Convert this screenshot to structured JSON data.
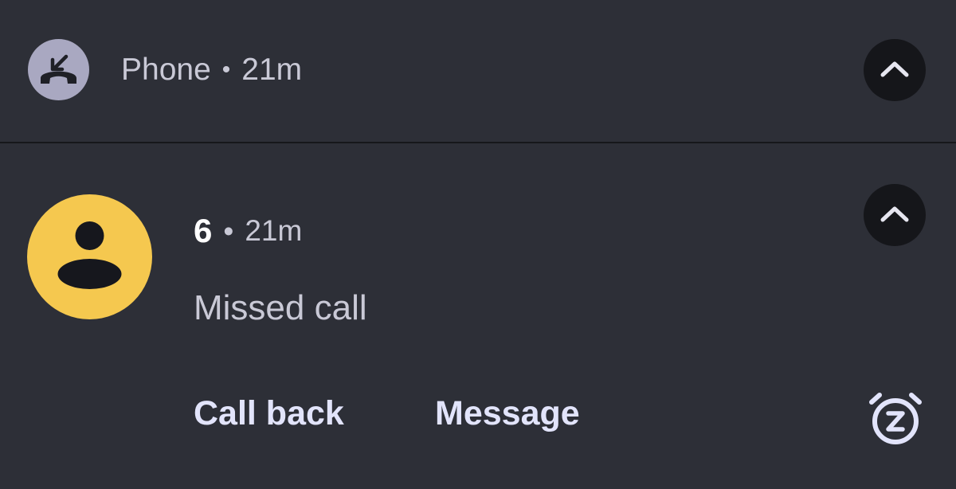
{
  "header": {
    "app_icon": "missed-call-icon",
    "app_name": "Phone",
    "separator": "•",
    "time": "21m",
    "collapse_icon": "chevron-up-icon"
  },
  "notification": {
    "avatar_icon": "person-icon",
    "caller": "6",
    "separator": "•",
    "time": "21m",
    "message": "Missed call",
    "collapse_icon": "chevron-up-icon",
    "actions": [
      {
        "label": "Call back"
      },
      {
        "label": "Message"
      }
    ],
    "snooze_icon": "snooze-alarm-icon"
  },
  "colors": {
    "background": "#2d2f37",
    "app_icon_bg": "#a9a8c1",
    "avatar_bg": "#f5c84f",
    "button_bg": "#15161a",
    "action_text": "#e2e4fb"
  }
}
